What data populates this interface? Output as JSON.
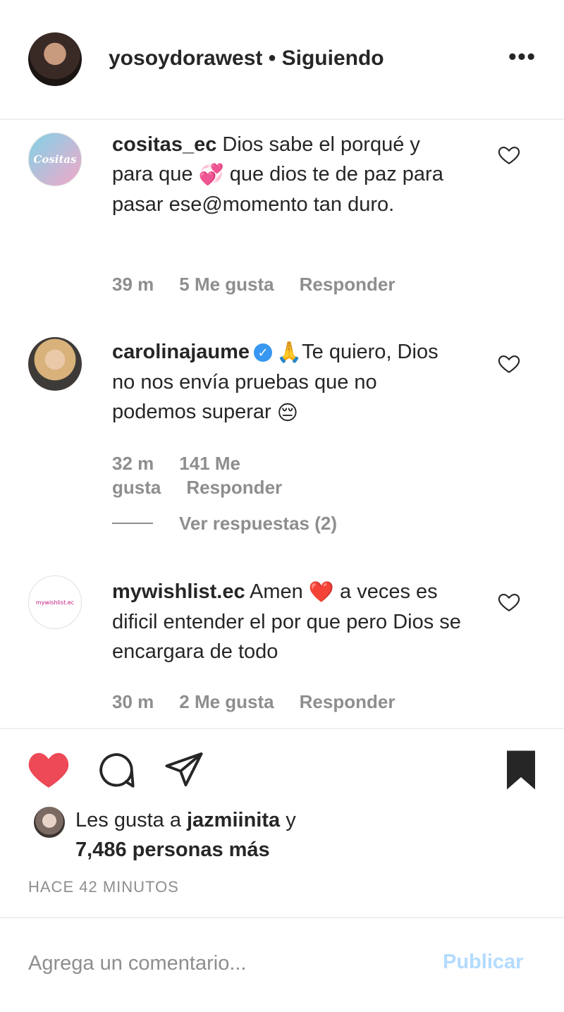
{
  "header": {
    "username": "yosoydorawest",
    "separator": " • ",
    "follow_status": "Siguiendo",
    "more_label": "•••"
  },
  "comments": [
    {
      "username": "cositas_ec",
      "avatar_text": "Cositas",
      "text_part1": " Dios sabe el porqué y para que ",
      "emoji": "💞",
      "text_part2": " que dios te de paz para pasar ese@momento tan duro.",
      "time": "39 m",
      "likes": "5 Me gusta",
      "reply": "Responder"
    },
    {
      "username": "carolinajaume",
      "verified_mark": "✓",
      "emoji": "🙏",
      "text_part1": "Te quiero, Dios no nos envía pruebas que no podemos superar ",
      "emoji2": "😔",
      "time": "32 m",
      "likes": "141 Me gusta",
      "reply": "Responder",
      "view_replies": "Ver respuestas (2)"
    },
    {
      "username": "mywishlist.ec",
      "avatar_text": "mywishlist.ec",
      "text_part1": " Amen ",
      "emoji": "❤️",
      "text_part2": " a veces es dificil entender el por que pero Dios se encargara de todo",
      "time": "30 m",
      "likes": "2 Me gusta",
      "reply": "Responder"
    }
  ],
  "likes": {
    "prefix": "Les gusta a ",
    "user": "jazmiinita",
    "middle": " y",
    "others": "7,486 personas más"
  },
  "timestamp": "HACE 42 MINUTOS",
  "comment_input": {
    "placeholder": "Agrega un comentario...",
    "value": ""
  },
  "publish_label": "Publicar",
  "colors": {
    "like_active": "#ed4956",
    "link_disabled": "#b3dbff",
    "muted": "#8e8e8e",
    "verified": "#3897f0"
  },
  "icons": [
    "more-options-icon",
    "heart-icon",
    "comment-icon",
    "share-icon",
    "bookmark-icon",
    "verified-badge-icon"
  ]
}
